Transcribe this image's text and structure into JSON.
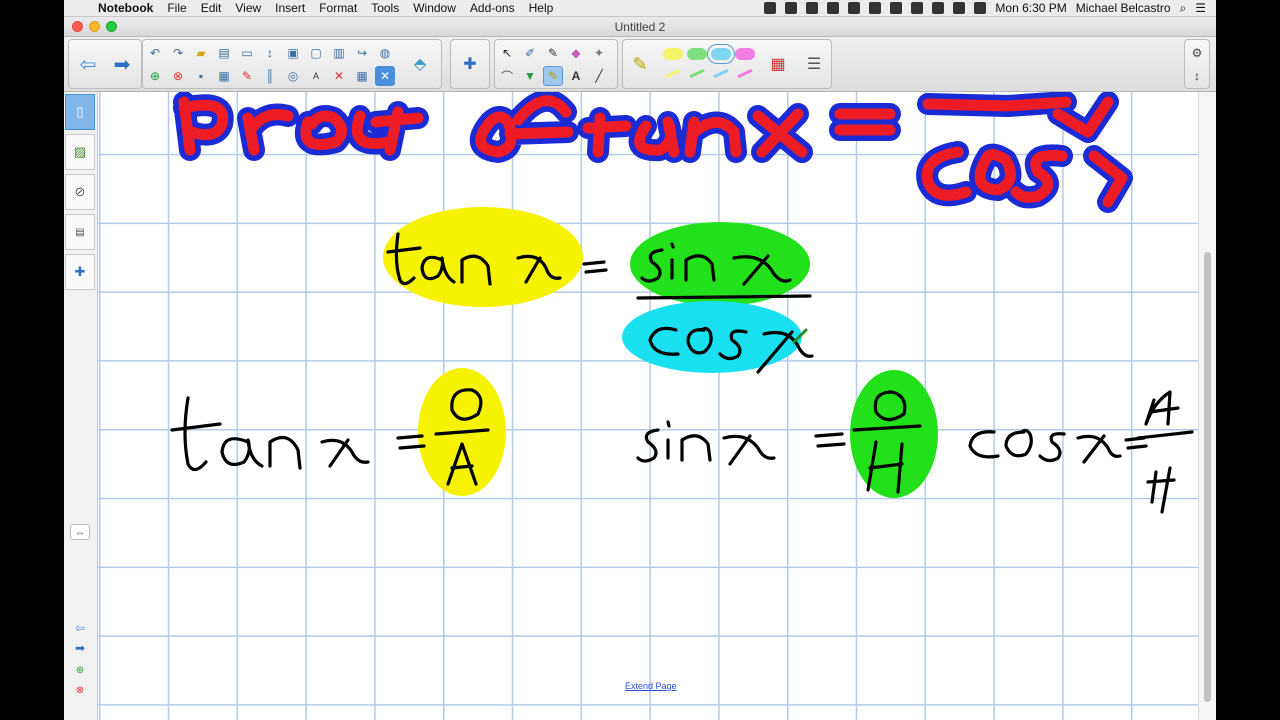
{
  "menubar": {
    "app_name": "Notebook",
    "items": [
      "File",
      "Edit",
      "View",
      "Insert",
      "Format",
      "Tools",
      "Window",
      "Add-ons",
      "Help"
    ],
    "clock": "Mon 6:30 PM",
    "user": "Michael Belcastro"
  },
  "window": {
    "title": "Untitled 2"
  },
  "toolbar": {
    "highlighter_colors": [
      "#f4f46a",
      "#7ee07e",
      "#7fd6f0",
      "#f07ee0"
    ],
    "selected_highlighter": 2
  },
  "canvas": {
    "extend_label": "Extend Page",
    "ink_colors": {
      "yellow": "#f7f200",
      "green": "#22e01a",
      "cyan": "#19e0ef",
      "red": "#ee1c24",
      "blue": "#1a2bd6",
      "black": "#000000"
    }
  }
}
